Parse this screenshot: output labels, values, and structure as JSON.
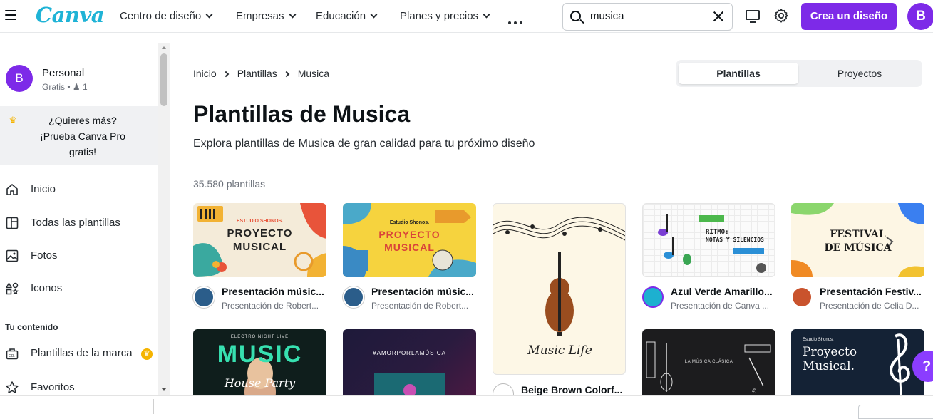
{
  "header": {
    "logo": "Canva",
    "nav": [
      {
        "label": "Centro de diseño"
      },
      {
        "label": "Empresas"
      },
      {
        "label": "Educación"
      },
      {
        "label": "Planes y precios"
      }
    ],
    "search": {
      "value": "musica"
    },
    "create_button": "Crea un diseño",
    "avatar_initial": "B"
  },
  "sidebar": {
    "profile": {
      "initial": "B",
      "name": "Personal",
      "plan": "Gratis",
      "members": "1"
    },
    "promo": {
      "line1": "¿Quieres más?",
      "line2": "¡Prueba Canva Pro",
      "line3": "gratis!"
    },
    "items": [
      {
        "label": "Inicio",
        "icon": "home-icon"
      },
      {
        "label": "Todas las plantillas",
        "icon": "templates-icon"
      },
      {
        "label": "Fotos",
        "icon": "photo-icon"
      },
      {
        "label": "Iconos",
        "icon": "shapes-icon"
      }
    ],
    "section_title": "Tu contenido",
    "content_items": [
      {
        "label": "Plantillas de la marca",
        "icon": "brand-templates-icon"
      },
      {
        "label": "Favoritos",
        "icon": "star-icon"
      }
    ]
  },
  "main": {
    "breadcrumb": [
      "Inicio",
      "Plantillas",
      "Musica"
    ],
    "tabs": {
      "active": "Plantillas",
      "inactive": "Proyectos"
    },
    "title": "Plantillas de Musica",
    "description": "Explora plantillas de Musica de gran calidad para tu próximo diseño",
    "count": "35.580 plantillas",
    "cards": [
      {
        "title": "Presentación músic...",
        "subtitle": "Presentación de Robert...",
        "thumb_text": [
          "ESTUDIO SHONOS.",
          "PROYECTO",
          "MUSICAL"
        ]
      },
      {
        "title": "Presentación músic...",
        "subtitle": "Presentación de Robert...",
        "thumb_text": [
          "Estudio Shonos.",
          "PROYECTO",
          "MUSICAL"
        ]
      },
      {
        "title": "Beige Brown Colorf...",
        "thumb_text": [
          "Music Life"
        ]
      },
      {
        "title": "Azul Verde Amarillo...",
        "subtitle": "Presentación de Canva ...",
        "thumb_text": [
          "RITMO:",
          "NOTAS Y SILENCIOS"
        ]
      },
      {
        "title": "Presentación Festiv...",
        "subtitle": "Presentación de Celia D...",
        "thumb_text": [
          "FESTIVAL",
          "DE MÚSICA"
        ]
      },
      {
        "thumb_text": [
          "ELECTRO NIGHT LIVE",
          "MUSIC",
          "House Party"
        ]
      },
      {
        "thumb_text": [
          "#AMORPORLAMÚSICA"
        ]
      },
      {
        "thumb_text": [
          "LA MÚSICA CLÁSICA"
        ]
      },
      {
        "thumb_text": [
          "Estudio Shonos.",
          "Proyecto",
          "Musical."
        ]
      }
    ]
  },
  "help_label": "?"
}
